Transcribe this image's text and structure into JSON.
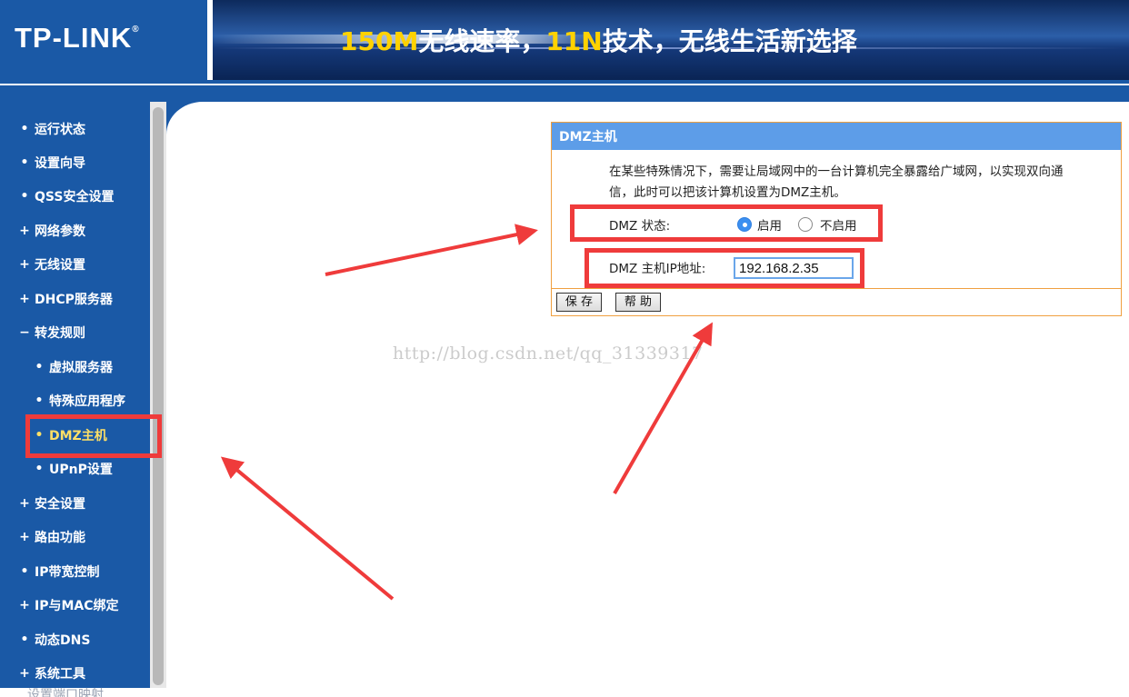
{
  "header": {
    "logo": "TP-LINK",
    "logo_reg": "®",
    "banner_part1": "150M",
    "banner_part2": "无线速率，",
    "banner_part3": "11N",
    "banner_part4": "技术，无线生活新选择"
  },
  "sidebar": {
    "items": [
      {
        "mark": "•",
        "label": "运行状态"
      },
      {
        "mark": "•",
        "label": "设置向导"
      },
      {
        "mark": "•",
        "label": "QSS安全设置"
      },
      {
        "mark": "+",
        "label": "网络参数"
      },
      {
        "mark": "+",
        "label": "无线设置"
      },
      {
        "mark": "+",
        "label": "DHCP服务器"
      },
      {
        "mark": "−",
        "label": "转发规则"
      },
      {
        "mark": "•",
        "label": "虚拟服务器"
      },
      {
        "mark": "•",
        "label": "特殊应用程序"
      },
      {
        "mark": "•",
        "label": "DMZ主机"
      },
      {
        "mark": "•",
        "label": "UPnP设置"
      },
      {
        "mark": "+",
        "label": "安全设置"
      },
      {
        "mark": "+",
        "label": "路由功能"
      },
      {
        "mark": "•",
        "label": "IP带宽控制"
      },
      {
        "mark": "+",
        "label": "IP与MAC绑定"
      },
      {
        "mark": "•",
        "label": "动态DNS"
      },
      {
        "mark": "+",
        "label": "系统工具"
      }
    ],
    "bottom_text": "设置端口映射"
  },
  "panel": {
    "title": "DMZ主机",
    "description": "在某些特殊情况下，需要让局域网中的一台计算机完全暴露给广域网，以实现双向通信，此时可以把该计算机设置为DMZ主机。",
    "status_label": "DMZ 状态:",
    "option_enable": "启用",
    "option_disable": "不启用",
    "selected": "启用",
    "ip_label": "DMZ 主机IP地址:",
    "ip_value": "192.168.2.35",
    "save_label": "保 存",
    "help_label": "帮 助"
  },
  "watermark": "http://blog.csdn.net/qq_31339317",
  "colors": {
    "sidebar_bg": "#1a59a6",
    "panel_header": "#5d9de8",
    "panel_border": "#f0a040",
    "annotation_red": "#ef3b3b",
    "active_menu": "#ffe066"
  }
}
